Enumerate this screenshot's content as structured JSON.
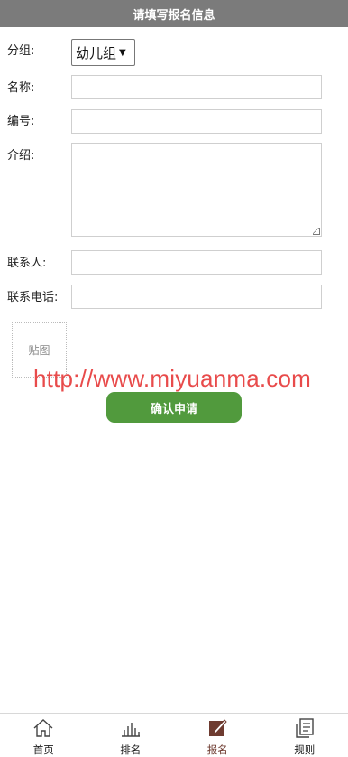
{
  "header": {
    "title": "请填写报名信息"
  },
  "form": {
    "group": {
      "label": "分组:",
      "value": "幼儿组"
    },
    "name": {
      "label": "名称:",
      "value": ""
    },
    "number": {
      "label": "编号:",
      "value": ""
    },
    "intro": {
      "label": "介绍:",
      "value": ""
    },
    "contact_person": {
      "label": "联系人:",
      "value": ""
    },
    "contact_phone": {
      "label": "联系电话:",
      "value": ""
    },
    "paste_label": "贴图"
  },
  "watermark": "http://www.miyuanma.com",
  "submit_label": "确认申请",
  "tabbar": {
    "items": [
      {
        "label": "首页",
        "icon": "home-icon"
      },
      {
        "label": "排名",
        "icon": "bar-chart-icon"
      },
      {
        "label": "报名",
        "icon": "edit-icon",
        "active": true
      },
      {
        "label": "规则",
        "icon": "document-icon"
      }
    ]
  },
  "colors": {
    "header": "#7b7b7b",
    "button": "#519a3d",
    "active_tab": "#6e3b30",
    "watermark": "#e84b4b"
  }
}
